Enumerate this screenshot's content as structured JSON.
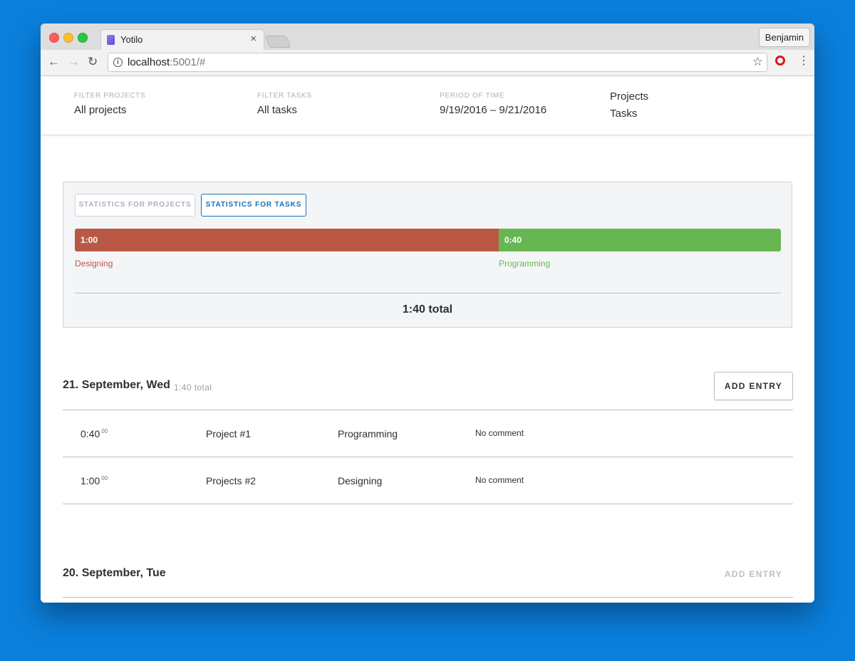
{
  "browser": {
    "tab_title": "Yotilo",
    "tab_close": "×",
    "profile_name": "Benjamin",
    "url_host": "localhost",
    "url_rest": ":5001/#",
    "back_glyph": "←",
    "forward_glyph": "→",
    "reload_glyph": "↻",
    "star_glyph": "☆",
    "menu_glyph": "⋮"
  },
  "filters": [
    {
      "label": "Filter projects",
      "value": "All projects"
    },
    {
      "label": "Filter tasks",
      "value": "All tasks"
    },
    {
      "label": "Period of time",
      "value": "9/19/2016 – 9/21/2016"
    }
  ],
  "nav": {
    "projects": "Projects",
    "tasks": "Tasks"
  },
  "statistics": {
    "projects_button": "Statistics for projects",
    "tasks_button": "Statistics for tasks",
    "active_view": "tasks",
    "segments": [
      {
        "name": "Designing",
        "time": "1:00",
        "minutes": 60,
        "color": "#b95845"
      },
      {
        "name": "Programming",
        "time": "0:40",
        "minutes": 40,
        "color": "#66b752"
      }
    ],
    "total": "1:40 total"
  },
  "days": [
    {
      "title": "21. September, Wed",
      "total": "1:40 total",
      "add_entry": "Add entry",
      "entries": [
        {
          "time": "0:40",
          "seconds": "00",
          "project": "Project #1",
          "task": "Programming",
          "comment": "No comment"
        },
        {
          "time": "1:00",
          "seconds": "00",
          "project": "Projects #2",
          "task": "Designing",
          "comment": "No comment"
        }
      ]
    },
    {
      "title": "20. September, Tue",
      "add_entry": "Add entry",
      "entries": []
    }
  ]
}
